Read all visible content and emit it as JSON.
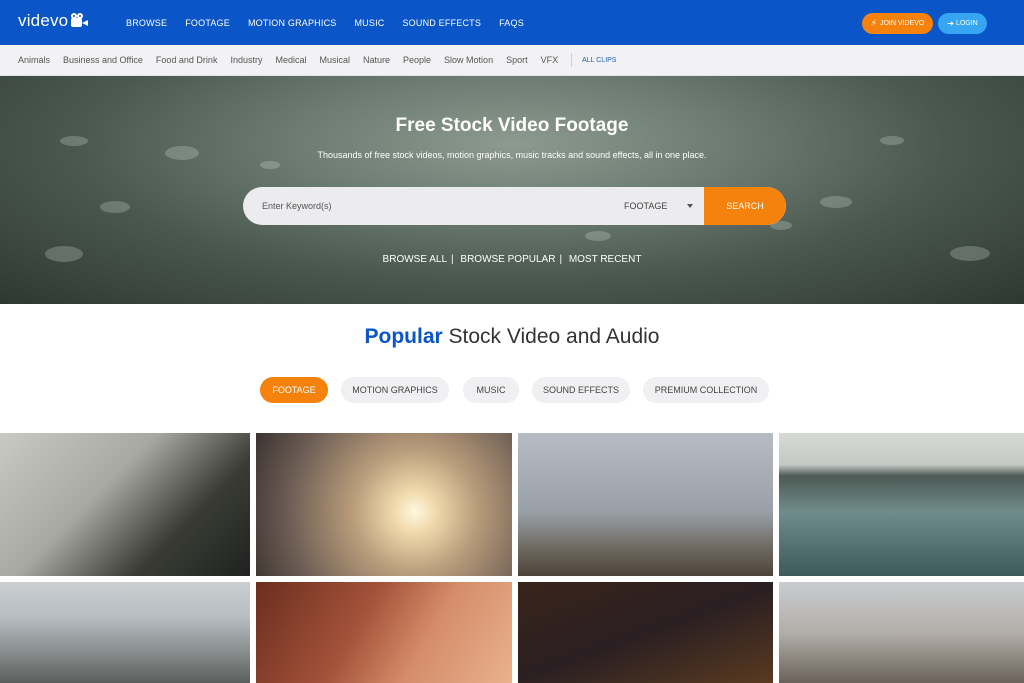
{
  "brand": {
    "logo_text": "videvo"
  },
  "nav": {
    "items": [
      "BROWSE",
      "FOOTAGE",
      "MOTION GRAPHICS",
      "MUSIC",
      "SOUND EFFECTS",
      "FAQS"
    ],
    "join_label": "JOIN VIDEVO",
    "login_label": "LOGIN"
  },
  "categories": {
    "items": [
      "Animals",
      "Business and Office",
      "Food and Drink",
      "Industry",
      "Medical",
      "Musical",
      "Nature",
      "People",
      "Slow Motion",
      "Sport",
      "VFX"
    ],
    "all_label": "ALL CLIPS"
  },
  "hero": {
    "title": "Free Stock Video Footage",
    "subtitle": "Thousands of free stock videos, motion graphics, music tracks and sound effects, all in one place.",
    "search_placeholder": "Enter Keyword(s)",
    "search_type": "FOOTAGE",
    "search_button": "SEARCH",
    "links": [
      "BROWSE ALL",
      "BROWSE POPULAR",
      "MOST RECENT"
    ]
  },
  "popular": {
    "title_highlight": "Popular",
    "title_rest": "Stock Video and Audio",
    "tabs": [
      "FOOTAGE",
      "MOTION GRAPHICS",
      "MUSIC",
      "SOUND EFFECTS",
      "PREMIUM COLLECTION"
    ],
    "active_tab": "FOOTAGE"
  },
  "colors": {
    "brand_blue": "#0a55c8",
    "accent_orange": "#f5820d",
    "login_blue": "#36a6f2"
  }
}
